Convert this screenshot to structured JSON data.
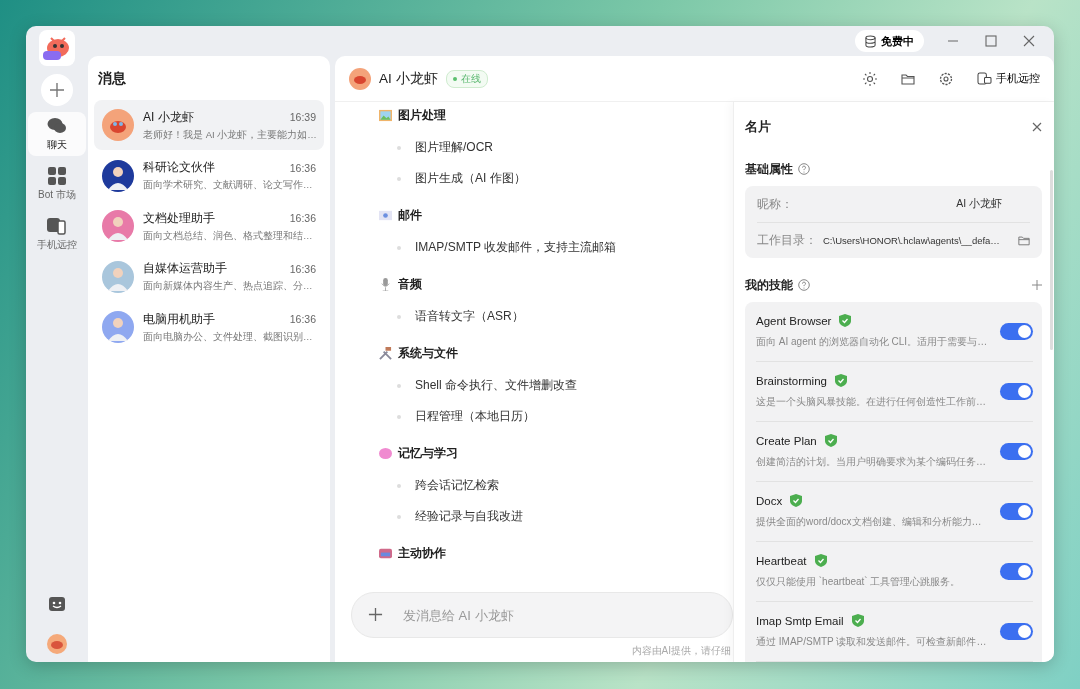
{
  "titlebar": {
    "plan_badge": "免费中"
  },
  "rail": {
    "nav": [
      {
        "label": "聊天",
        "selected": true
      },
      {
        "label": "Bot 市场",
        "selected": false
      },
      {
        "label": "手机远控",
        "selected": false
      }
    ]
  },
  "messages": {
    "title": "消息",
    "items": [
      {
        "name": "AI 小龙虾",
        "time": "16:39",
        "preview": "老师好！我是 AI 小龙虾，主要能力如…",
        "selected": true
      },
      {
        "name": "科研论文伙伴",
        "time": "16:36",
        "preview": "面向学术研究、文献调研、论文写作…",
        "selected": false
      },
      {
        "name": "文档处理助手",
        "time": "16:36",
        "preview": "面向文档总结、润色、格式整理和结…",
        "selected": false
      },
      {
        "name": "自媒体运营助手",
        "time": "16:36",
        "preview": "面向新媒体内容生产、热点追踪、分…",
        "selected": false
      },
      {
        "name": "电脑用机助手",
        "time": "16:36",
        "preview": "面向电脑办公、文件处理、截图识别…",
        "selected": false
      }
    ]
  },
  "chat": {
    "title": "AI 小龙虾",
    "status": "在线",
    "remote_button": "手机远控",
    "sections": [
      {
        "heading": "图片处理",
        "items": [
          "图片理解/OCR",
          "图片生成（AI 作图）"
        ]
      },
      {
        "heading": "邮件",
        "items": [
          "IMAP/SMTP 收发邮件，支持主流邮箱"
        ]
      },
      {
        "heading": "音频",
        "items": [
          "语音转文字（ASR）"
        ]
      },
      {
        "heading": "系统与文件",
        "items": [
          "Shell 命令执行、文件增删改查",
          "日程管理（本地日历）"
        ]
      },
      {
        "heading": "记忆与学习",
        "items": [
          "跨会话记忆检索",
          "经验记录与自我改进"
        ]
      },
      {
        "heading": "主动协作"
      }
    ],
    "composer": {
      "placeholder": "发消息给 AI 小龙虾"
    },
    "footer": "内容由AI提供，请仔细"
  },
  "card": {
    "title": "名片",
    "basic": {
      "heading": "基础属性",
      "fields": [
        {
          "label": "昵称：",
          "value": "AI 小龙虾",
          "kind": "text"
        },
        {
          "label": "工作目录：",
          "value": "C:\\Users\\HONOR\\.hclaw\\agents\\__defa…",
          "kind": "folder"
        }
      ]
    },
    "skills": {
      "heading": "我的技能",
      "items": [
        {
          "name": "Agent Browser",
          "verified": true,
          "on": true,
          "desc": "面向 AI agent 的浏览器自动化 CLI。适用于需要与…"
        },
        {
          "name": "Brainstorming",
          "verified": true,
          "on": true,
          "desc": "这是一个头脑风暴技能。在进行任何创造性工作前…"
        },
        {
          "name": "Create Plan",
          "verified": true,
          "on": true,
          "desc": "创建简洁的计划。当用户明确要求为某个编码任务…"
        },
        {
          "name": "Docx",
          "verified": true,
          "on": true,
          "desc": "提供全面的word/docx文档创建、编辑和分析能力…"
        },
        {
          "name": "Heartbeat",
          "verified": true,
          "on": true,
          "desc": "仅仅只能使用 `heartbeat` 工具管理心跳服务。"
        },
        {
          "name": "Imap Smtp Email",
          "verified": true,
          "on": true,
          "desc": "通过 IMAP/SMTP 读取和发送邮件。可检查新邮件…"
        }
      ]
    }
  }
}
